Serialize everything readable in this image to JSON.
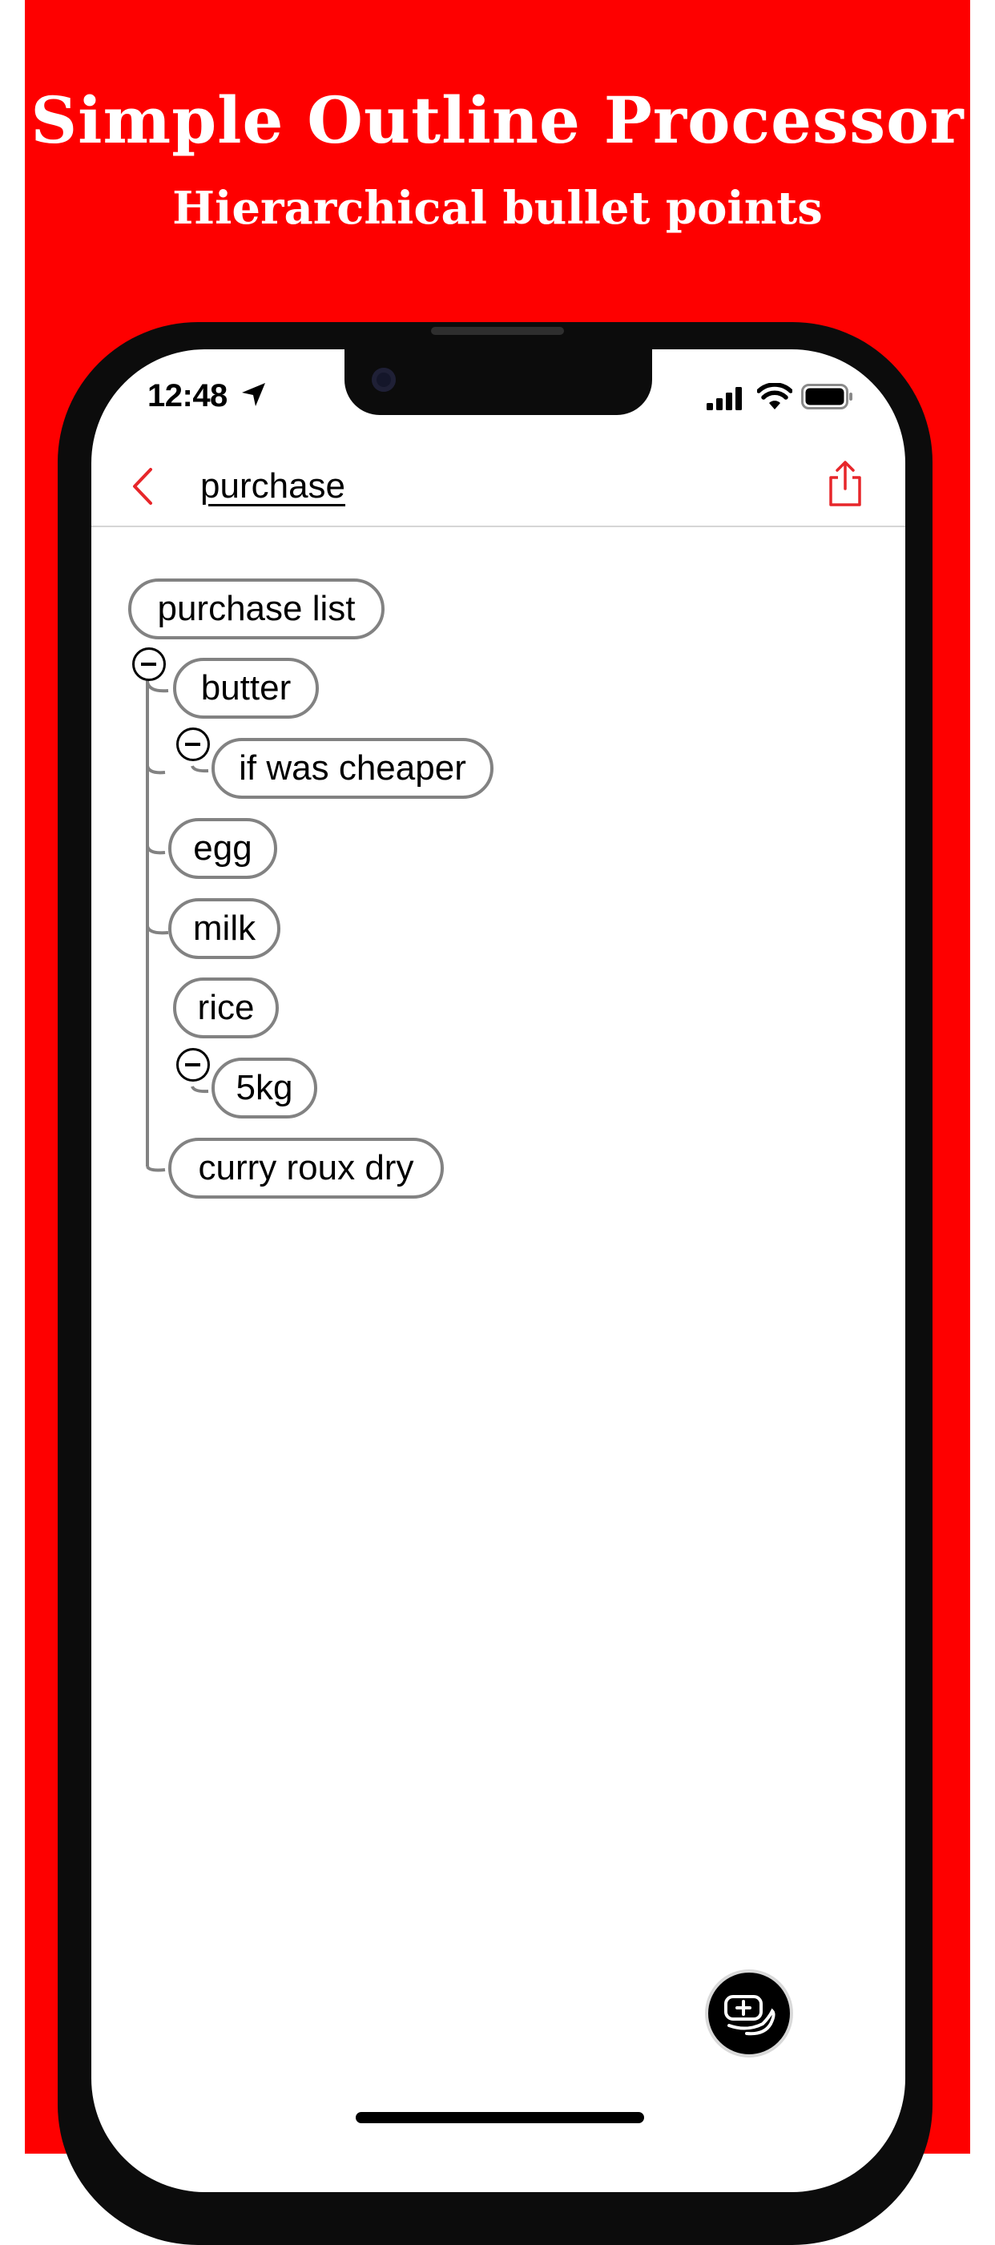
{
  "promo": {
    "headline": "Simple Outline Processor",
    "subhead": "Hierarchical bullet points",
    "background_color": "#fe0000"
  },
  "status_bar": {
    "time": "12:48"
  },
  "nav": {
    "title": "purchase",
    "accent_color": "#e7262a",
    "back_icon": "chevron-left-icon",
    "share_icon": "share-icon"
  },
  "outline": {
    "root": "purchase list",
    "items": [
      {
        "label": "butter",
        "children": [
          {
            "label": "if was cheaper"
          }
        ]
      },
      {
        "label": "egg"
      },
      {
        "label": "milk"
      },
      {
        "label": "rice",
        "children": [
          {
            "label": "5kg"
          }
        ]
      },
      {
        "label": "curry roux dry"
      }
    ]
  },
  "fab": {
    "icon": "add-item-icon"
  }
}
